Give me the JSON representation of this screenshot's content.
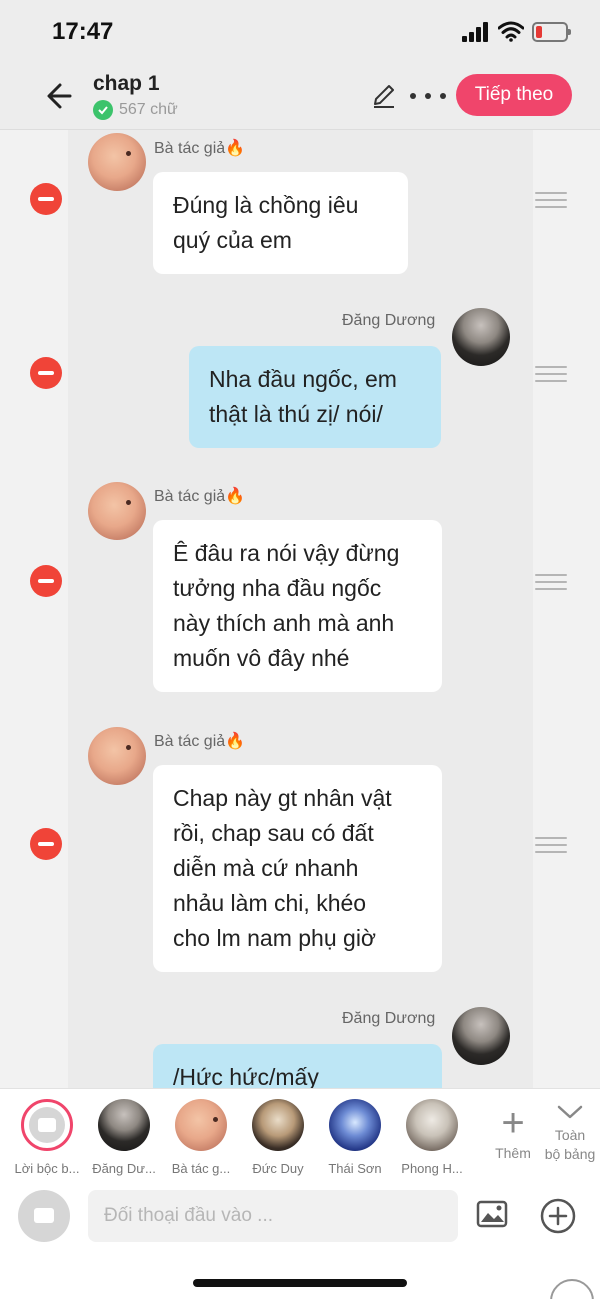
{
  "status": {
    "time": "17:47"
  },
  "header": {
    "title": "chap 1",
    "word_count": "567 chữ",
    "next_label": "Tiếp theo"
  },
  "messages": [
    {
      "speaker": "Bà tác giả🔥",
      "side": "left",
      "text": [
        "Đúng là chồng iêu",
        "quý của em"
      ]
    },
    {
      "speaker": "Đăng Dương",
      "side": "right",
      "text": [
        "Nha đầu ngốc, em",
        "thật là thú zị/ nói/"
      ]
    },
    {
      "speaker": "Bà tác giả🔥",
      "side": "left",
      "text": [
        "Ê đâu ra nói vậy đừng",
        "tưởng nha đầu ngốc",
        "này thích anh mà anh",
        "muốn vô đây nhé"
      ]
    },
    {
      "speaker": "Bà tác giả🔥",
      "side": "left",
      "text": [
        "Chap này gt nhân vật",
        "rồi, chap sau có đất",
        "diễn mà cứ nhanh",
        "nhảu làm chi, khéo",
        "cho lm nam phụ giờ"
      ]
    },
    {
      "speaker": "Đăng Dương",
      "side": "right",
      "text": [
        "/Hức hức/mấy"
      ]
    }
  ],
  "characters": [
    {
      "label": "Lời bộc b..."
    },
    {
      "label": "Đăng Dư..."
    },
    {
      "label": "Bà tác g..."
    },
    {
      "label": "Đức Duy"
    },
    {
      "label": "Thái Sơn"
    },
    {
      "label": "Phong H..."
    }
  ],
  "strip": {
    "add_label": "Thêm",
    "board_label_1": "Toàn",
    "board_label_2": "bộ bảng"
  },
  "composer": {
    "placeholder": "Đối thoại đầu vào ..."
  }
}
